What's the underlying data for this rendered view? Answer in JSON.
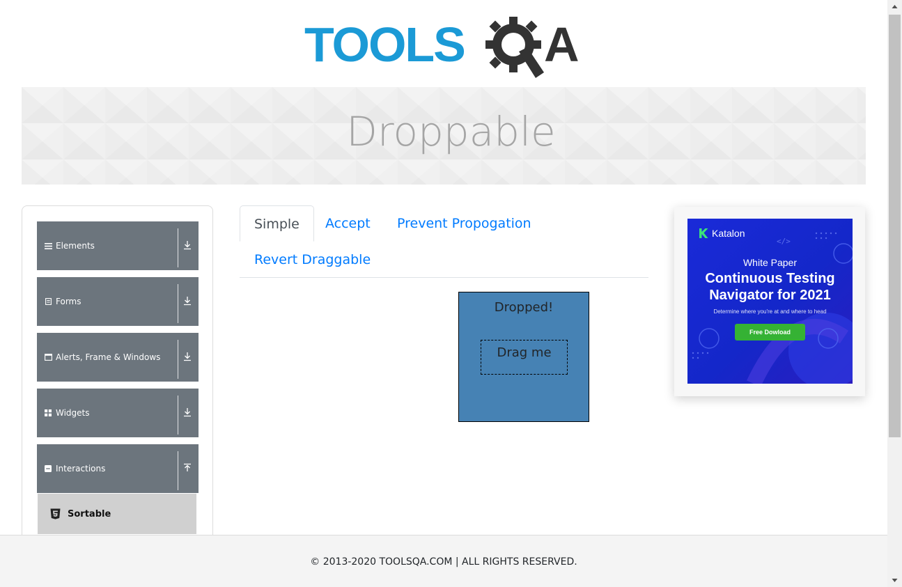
{
  "logo": {
    "text_left": "TOOLS",
    "text_right": "A",
    "icon": "gear-q-icon"
  },
  "banner": {
    "title": "Droppable"
  },
  "sidebar": {
    "groups": [
      {
        "label": "Elements",
        "icon": "hamburger-icon",
        "chevron": "download-icon"
      },
      {
        "label": "Forms",
        "icon": "form-icon",
        "chevron": "download-icon"
      },
      {
        "label": "Alerts, Frame & Windows",
        "icon": "window-icon",
        "chevron": "download-icon"
      },
      {
        "label": "Widgets",
        "icon": "grid-icon",
        "chevron": "download-icon"
      },
      {
        "label": "Interactions",
        "icon": "interactions-icon",
        "chevron": "upload-icon"
      }
    ],
    "active_item": {
      "label": "Sortable",
      "icon": "html5-icon"
    }
  },
  "tabs": [
    {
      "label": "Simple",
      "active": true
    },
    {
      "label": "Accept",
      "active": false
    },
    {
      "label": "Prevent Propogation",
      "active": false
    },
    {
      "label": "Revert Draggable",
      "active": false
    }
  ],
  "droppable": {
    "label": "Dropped!",
    "color": "#4682b4"
  },
  "draggable": {
    "label": "Drag me"
  },
  "ad": {
    "brand": "Katalon",
    "kicker": "White Paper",
    "headline_line1": "Continuous Testing",
    "headline_line2": "Navigator for 2021",
    "subline": "Determine where you're at and where to head",
    "cta": "Free Dowload"
  },
  "footer": {
    "text": "© 2013-2020 TOOLSQA.COM | ALL RIGHTS RESERVED."
  },
  "colors": {
    "brand_blue": "#1b9ad6",
    "link": "#007bff",
    "sidebar_group": "#6c757d",
    "cta_green": "#35b234"
  }
}
